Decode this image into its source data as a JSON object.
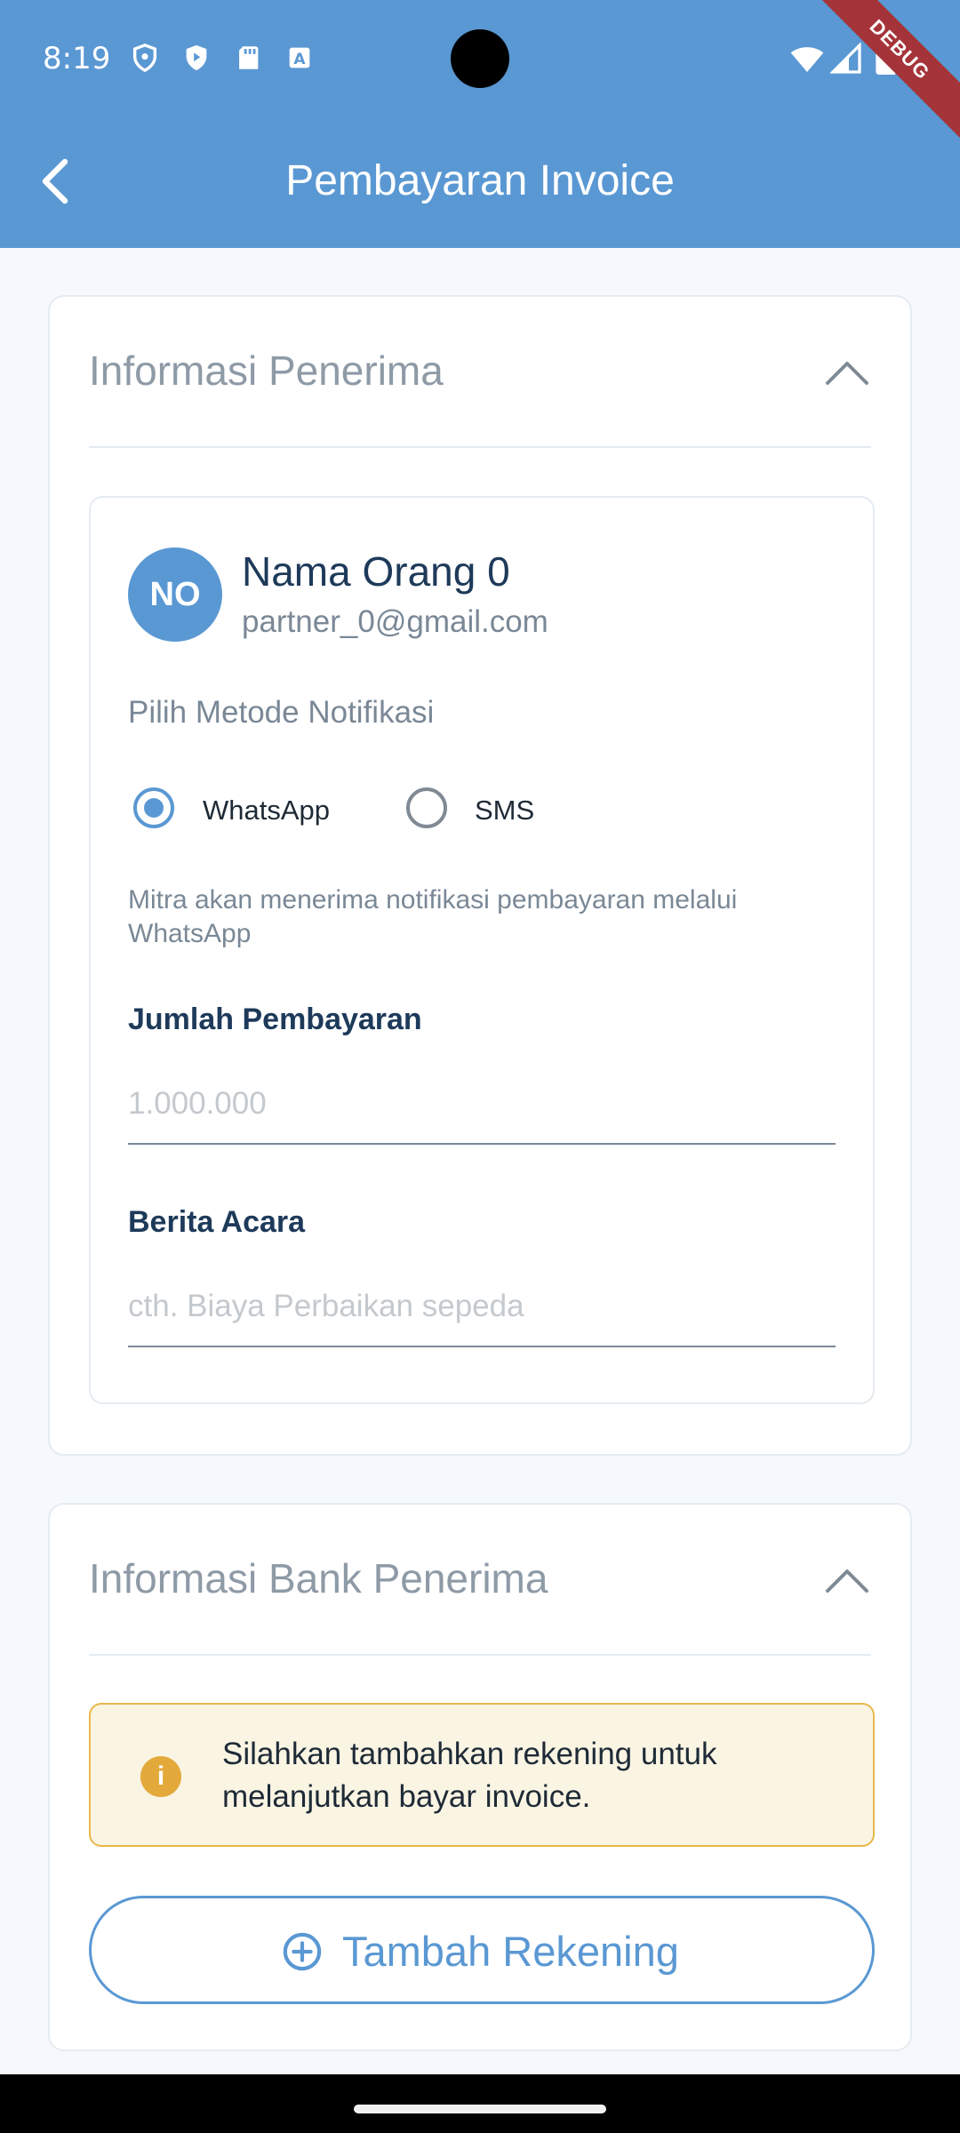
{
  "status": {
    "time": "8:19",
    "debug_label": "DEBUG",
    "icons": [
      "shield-icon",
      "play-protect-icon",
      "sd-card-icon",
      "keyboard-icon",
      "wifi-icon",
      "signal-icon",
      "battery-icon"
    ]
  },
  "appbar": {
    "title": "Pembayaran Invoice",
    "back_icon": "chevron-left-icon"
  },
  "recipient_section": {
    "title": "Informasi Penerima",
    "expanded": true,
    "partner": {
      "initials": "NO",
      "name": "Nama Orang 0",
      "email": "partner_0@gmail.com"
    },
    "notification_label": "Pilih Metode Notifikasi",
    "options": [
      {
        "label": "WhatsApp",
        "selected": true
      },
      {
        "label": "SMS",
        "selected": false
      }
    ],
    "hint": "Mitra akan menerima notifikasi pembayaran melalui WhatsApp",
    "amount": {
      "label": "Jumlah Pembayaran",
      "placeholder": "1.000.000",
      "value": ""
    },
    "note": {
      "label": "Berita Acara",
      "placeholder": "cth. Biaya Perbaikan sepeda",
      "value": ""
    }
  },
  "bank_section": {
    "title": "Informasi Bank Penerima",
    "expanded": true,
    "warning": "Silahkan tambahkan rekening untuk melanjutkan bayar invoice.",
    "add_button": "Tambah Rekening"
  },
  "colors": {
    "primary": "#5a98d3",
    "warning_bg": "#faf4e3",
    "warning_border": "#e8b84a",
    "debug": "#a5343a"
  }
}
